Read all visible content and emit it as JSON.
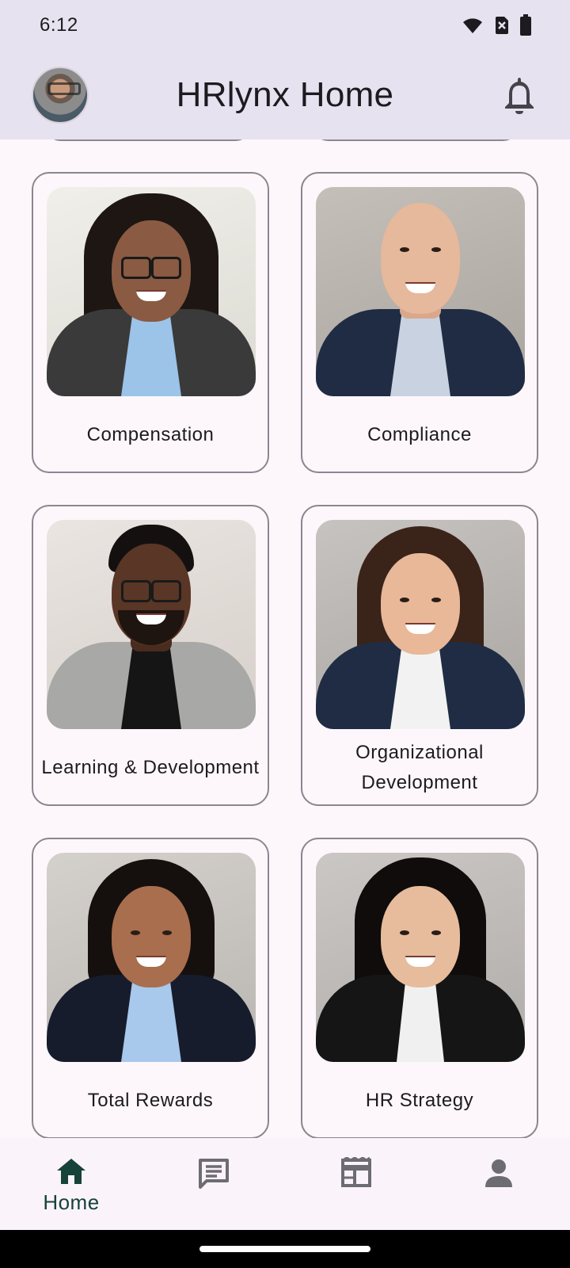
{
  "status_bar": {
    "time": "6:12",
    "icons": [
      "wifi-icon",
      "no-sim-icon",
      "battery-icon"
    ]
  },
  "app_bar": {
    "title": "HRlynx Home",
    "avatar": "profile-avatar",
    "action_icon": "bell-icon"
  },
  "cards": [
    {
      "label": "Compensation"
    },
    {
      "label": "Compliance"
    },
    {
      "label": "Learning & Development"
    },
    {
      "label": "Organizational Development"
    },
    {
      "label": "Total Rewards"
    },
    {
      "label": "HR Strategy"
    }
  ],
  "bottom_nav": {
    "items": [
      {
        "label": "Home",
        "icon": "home-icon",
        "selected": true
      },
      {
        "label": "",
        "icon": "chat-icon",
        "selected": false
      },
      {
        "label": "",
        "icon": "newspaper-icon",
        "selected": false
      },
      {
        "label": "",
        "icon": "person-icon",
        "selected": false
      }
    ]
  },
  "colors": {
    "app_bar_bg": "#e7e2ef",
    "page_bg": "#fdf7fc",
    "nav_selected": "#17423a",
    "nav_unselected": "#6e6c73",
    "card_border": "#8b8690"
  }
}
